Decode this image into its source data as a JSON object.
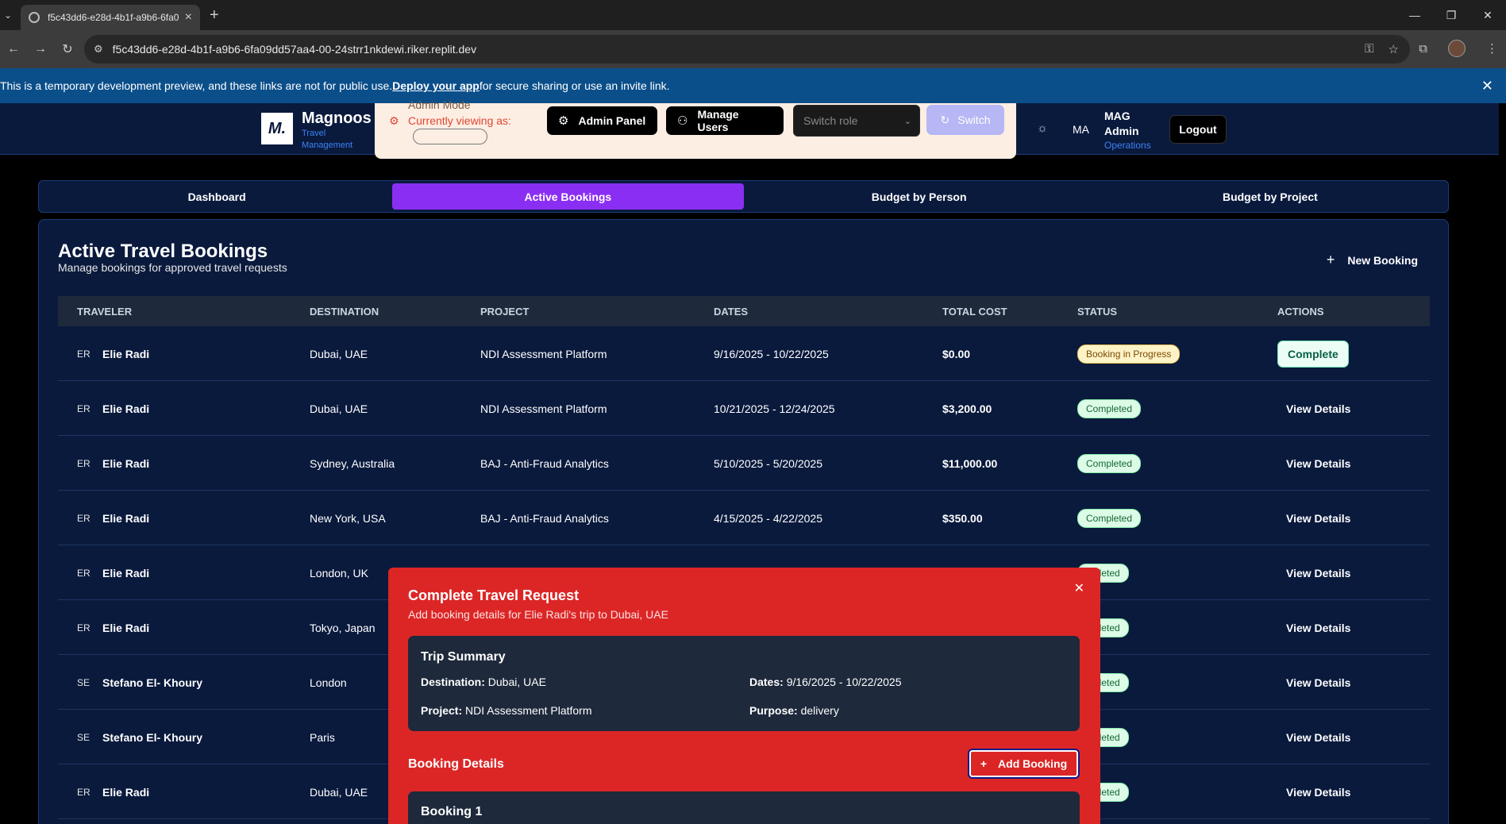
{
  "browser": {
    "tab_title": "f5c43dd6-e28d-4b1f-a9b6-6fa0",
    "url": "f5c43dd6-e28d-4b1f-a9b6-6fa09dd57aa4-00-24strr1nkdewi.riker.replit.dev"
  },
  "banner": {
    "text_before": "This is a temporary development preview, and these links are not for public use. ",
    "link": "Deploy your app",
    "text_after": " for secure sharing or use an invite link."
  },
  "header": {
    "logo_mark": "M.",
    "brand_name": "Magnoos",
    "brand_sub_1": "Travel",
    "brand_sub_2": "Management",
    "admin_mode": "Admin Mode",
    "viewing_as": "Currently viewing as:",
    "admin_panel": "Admin Panel",
    "manage_users": "Manage Users",
    "switch_role_placeholder": "Switch role",
    "switch": "Switch",
    "user_initials": "MA",
    "user_name_1": "MAG",
    "user_name_2": "Admin",
    "user_dept": "Operations",
    "logout": "Logout"
  },
  "tabs": [
    "Dashboard",
    "Active Bookings",
    "Budget by Person",
    "Budget by Project"
  ],
  "active_tab": "Active Bookings",
  "main": {
    "title": "Active Travel Bookings",
    "subtitle": "Manage bookings for approved travel requests",
    "new_booking": "New Booking",
    "columns": [
      "TRAVELER",
      "DESTINATION",
      "PROJECT",
      "DATES",
      "TOTAL COST",
      "STATUS",
      "ACTIONS"
    ],
    "rows": [
      {
        "initials": "ER",
        "traveler": "Elie Radi",
        "destination": "Dubai, UAE",
        "project": "NDI Assessment Platform",
        "dates": "9/16/2025 - 10/22/2025",
        "cost": "$0.00",
        "status": "Booking in Progress",
        "action": "Complete"
      },
      {
        "initials": "ER",
        "traveler": "Elie Radi",
        "destination": "Dubai, UAE",
        "project": "NDI Assessment Platform",
        "dates": "10/21/2025 - 12/24/2025",
        "cost": "$3,200.00",
        "status": "Completed",
        "action": "View Details"
      },
      {
        "initials": "ER",
        "traveler": "Elie Radi",
        "destination": "Sydney, Australia",
        "project": "BAJ - Anti-Fraud Analytics",
        "dates": "5/10/2025 - 5/20/2025",
        "cost": "$11,000.00",
        "status": "Completed",
        "action": "View Details"
      },
      {
        "initials": "ER",
        "traveler": "Elie Radi",
        "destination": "New York, USA",
        "project": "BAJ - Anti-Fraud Analytics",
        "dates": "4/15/2025 - 4/22/2025",
        "cost": "$350.00",
        "status": "Completed",
        "action": "View Details"
      },
      {
        "initials": "ER",
        "traveler": "Elie Radi",
        "destination": "London, UK",
        "project": "",
        "dates": "",
        "cost": "",
        "status": "mpleted",
        "action": "View Details"
      },
      {
        "initials": "ER",
        "traveler": "Elie Radi",
        "destination": "Tokyo, Japan",
        "project": "",
        "dates": "",
        "cost": "",
        "status": "mpleted",
        "action": "View Details"
      },
      {
        "initials": "SE",
        "traveler": "Stefano El- Khoury",
        "destination": "London",
        "project": "",
        "dates": "",
        "cost": "",
        "status": "mpleted",
        "action": "View Details"
      },
      {
        "initials": "SE",
        "traveler": "Stefano El- Khoury",
        "destination": "Paris",
        "project": "",
        "dates": "",
        "cost": "",
        "status": "mpleted",
        "action": "View Details"
      },
      {
        "initials": "ER",
        "traveler": "Elie Radi",
        "destination": "Dubai, UAE",
        "project": "",
        "dates": "",
        "cost": "",
        "status": "mpleted",
        "action": "View Details"
      }
    ]
  },
  "modal": {
    "title": "Complete Travel Request",
    "subtitle": "Add booking details for Elie Radi's trip to Dubai, UAE",
    "trip_summary": "Trip Summary",
    "destination_label": "Destination:",
    "destination": "Dubai, UAE",
    "dates_label": "Dates:",
    "dates": "9/16/2025 - 10/22/2025",
    "project_label": "Project:",
    "project": "NDI Assessment Platform",
    "purpose_label": "Purpose:",
    "purpose": "delivery",
    "booking_details": "Booking Details",
    "add_booking": "Add Booking",
    "booking_1": "Booking 1"
  }
}
